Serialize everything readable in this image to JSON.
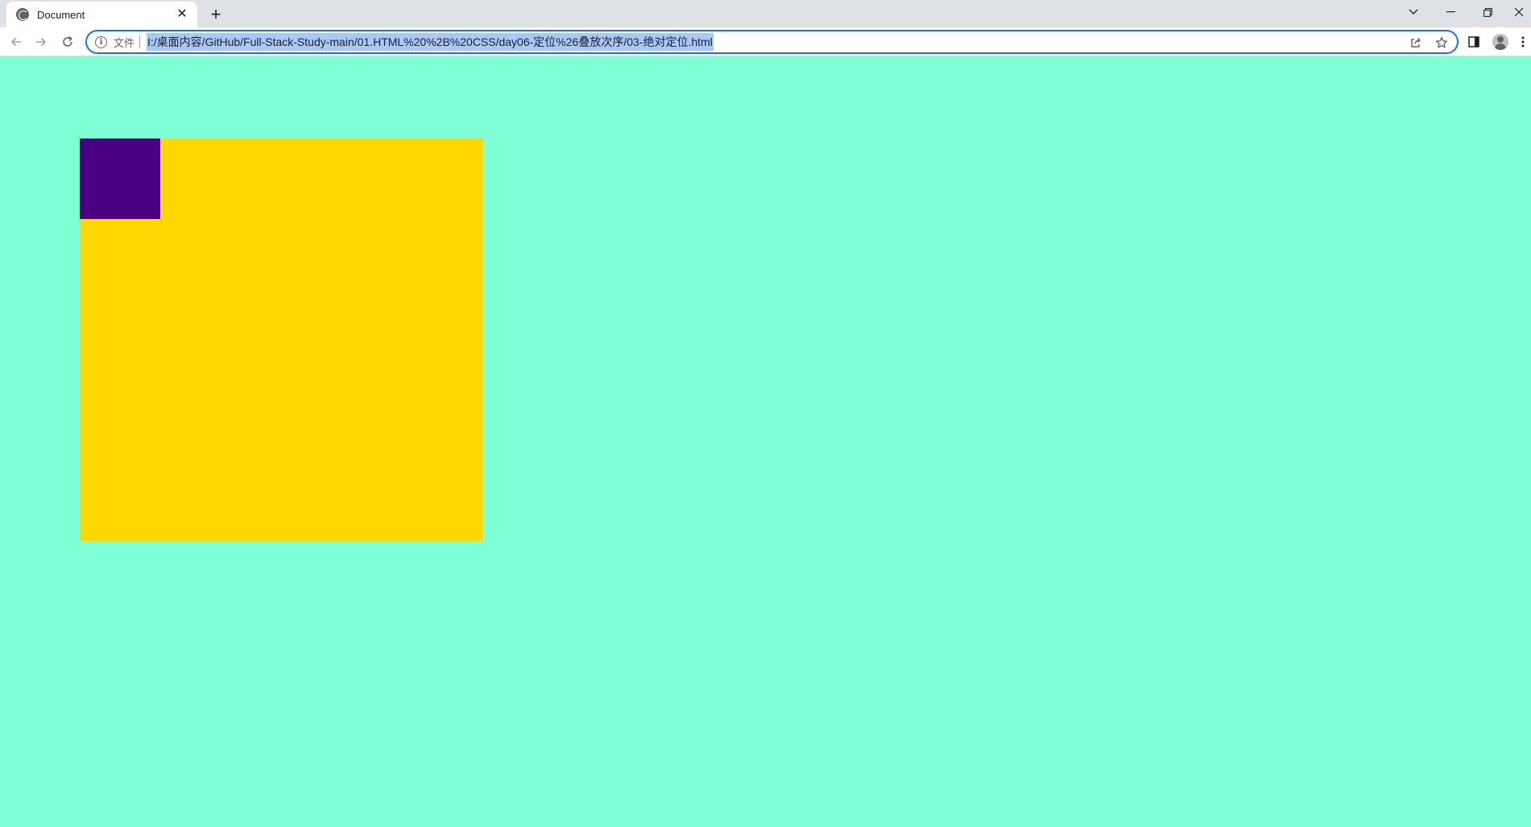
{
  "browser": {
    "tab": {
      "title": "Document",
      "favicon": "globe-icon",
      "close_glyph": "✕"
    },
    "new_tab_glyph": "+",
    "toolbar": {
      "back_icon": "back-arrow-icon",
      "forward_icon": "forward-arrow-icon",
      "reload_icon": "reload-icon"
    },
    "omnibox": {
      "info_glyph": "i",
      "scheme_label": "文件",
      "url": "I:/桌面内容/GitHub/Full-Stack-Study-main/01.HTML%20%2B%20CSS/day06-定位%26叠放次序/03-绝对定位.html"
    }
  },
  "page": {
    "background_color": "#7fffd4",
    "parent_box_color": "#ffd700",
    "child_box_color": "#4b0082"
  }
}
